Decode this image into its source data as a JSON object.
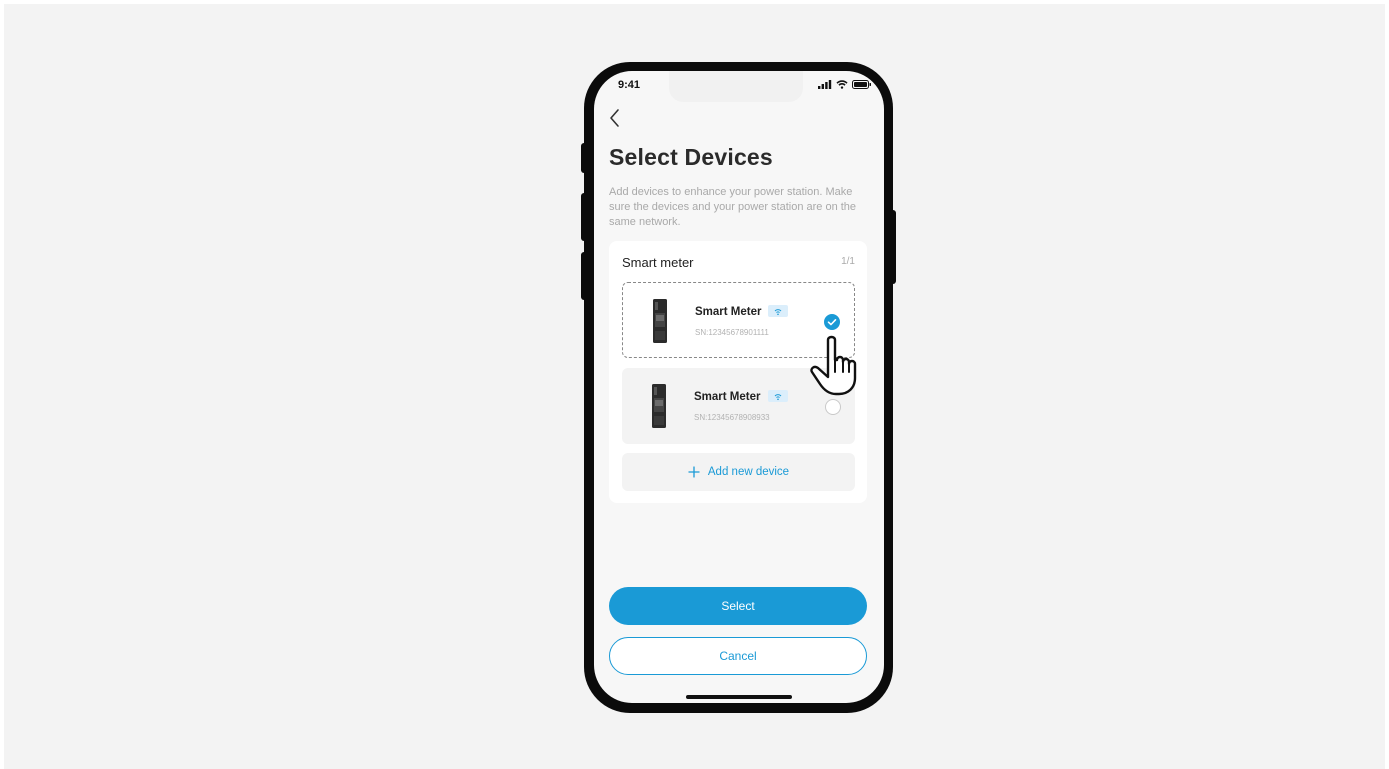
{
  "status_bar": {
    "time": "9:41"
  },
  "page": {
    "title": "Select Devices",
    "description": "Add devices to enhance your power station. Make sure the devices and your power station are on the same network."
  },
  "card": {
    "header": "Smart meter",
    "count": "1/1",
    "devices": [
      {
        "name": "Smart Meter",
        "sn": "SN:12345678901111",
        "selected": true
      },
      {
        "name": "Smart Meter",
        "sn": "SN:12345678908933",
        "selected": false
      }
    ],
    "add_label": "Add new device"
  },
  "actions": {
    "primary_label": "Select",
    "secondary_label": "Cancel"
  },
  "colors": {
    "accent": "#1a9ad6",
    "background": "#f3f3f3",
    "text": "#2b2b2b"
  },
  "icons": [
    "back-chevron-icon",
    "signal-icon",
    "wifi-icon",
    "battery-icon",
    "checkmark-icon",
    "plus-icon",
    "pointer-hand-icon"
  ]
}
